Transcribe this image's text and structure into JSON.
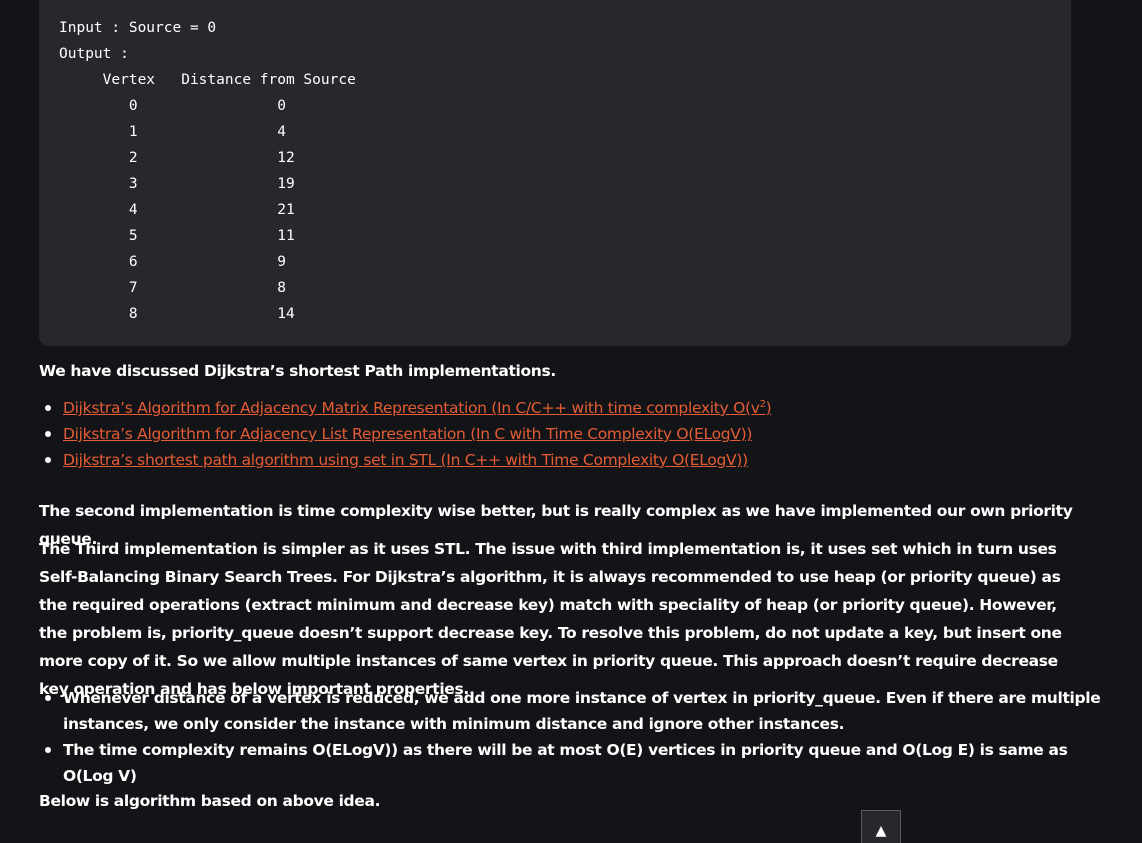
{
  "code_output": {
    "input_line": "Input : Source = 0",
    "output_label": "Output :",
    "header": {
      "vertex": "Vertex",
      "distance": "Distance from Source"
    },
    "rows": [
      {
        "vertex": "0",
        "distance": "0"
      },
      {
        "vertex": "1",
        "distance": "4"
      },
      {
        "vertex": "2",
        "distance": "12"
      },
      {
        "vertex": "3",
        "distance": "19"
      },
      {
        "vertex": "4",
        "distance": "21"
      },
      {
        "vertex": "5",
        "distance": "11"
      },
      {
        "vertex": "6",
        "distance": "9"
      },
      {
        "vertex": "7",
        "distance": "8"
      },
      {
        "vertex": "8",
        "distance": "14"
      }
    ]
  },
  "intro_text": "We have discussed Dijkstra’s shortest Path implementations.",
  "links": [
    {
      "text": "Dijkstra’s Algorithm for Adjacency Matrix Representation (In C/C++ with time complexity O(v",
      "sup": "2",
      "suffix": ")"
    },
    {
      "text": "Dijkstra’s Algorithm for Adjacency List Representation (In C with Time Complexity O(ELogV))",
      "sup": "",
      "suffix": ""
    },
    {
      "text": "Dijkstra’s shortest path algorithm using set in STL (In C++ with Time Complexity O(ELogV))",
      "sup": "",
      "suffix": ""
    }
  ],
  "para_second": "The second implementation is time complexity wise better, but is really complex as we have implemented our own priority queue.",
  "para_third": "The Third implementation is simpler as it uses STL. The issue with third implementation is, it uses set which in turn uses Self-Balancing Binary Search Trees. For Dijkstra’s algorithm, it is always recommended to use heap (or priority queue) as the required operations (extract minimum and decrease key) match with speciality of heap (or priority queue). However, the problem is, priority_queue doesn’t support decrease key. To resolve this problem, do not update a key, but insert one more copy of it. So we allow multiple instances of same vertex in priority queue. This approach doesn’t require decrease key operation and has below important properties.",
  "properties": [
    "Whenever distance of a vertex is reduced, we add one more instance of vertex in priority_queue. Even if there are multiple instances, we only consider the instance with minimum distance and ignore other instances.",
    "The time complexity remains O(ELogV)) as there will be at most O(E) vertices in priority queue and O(Log E) is same as O(Log V)"
  ],
  "para_below": "Below is algorithm based on above idea.",
  "scroll_top_icon": "▲",
  "colors": {
    "background": "#131417",
    "code_bg": "#27282d",
    "link": "#e45c35",
    "text": "#ffffff"
  }
}
